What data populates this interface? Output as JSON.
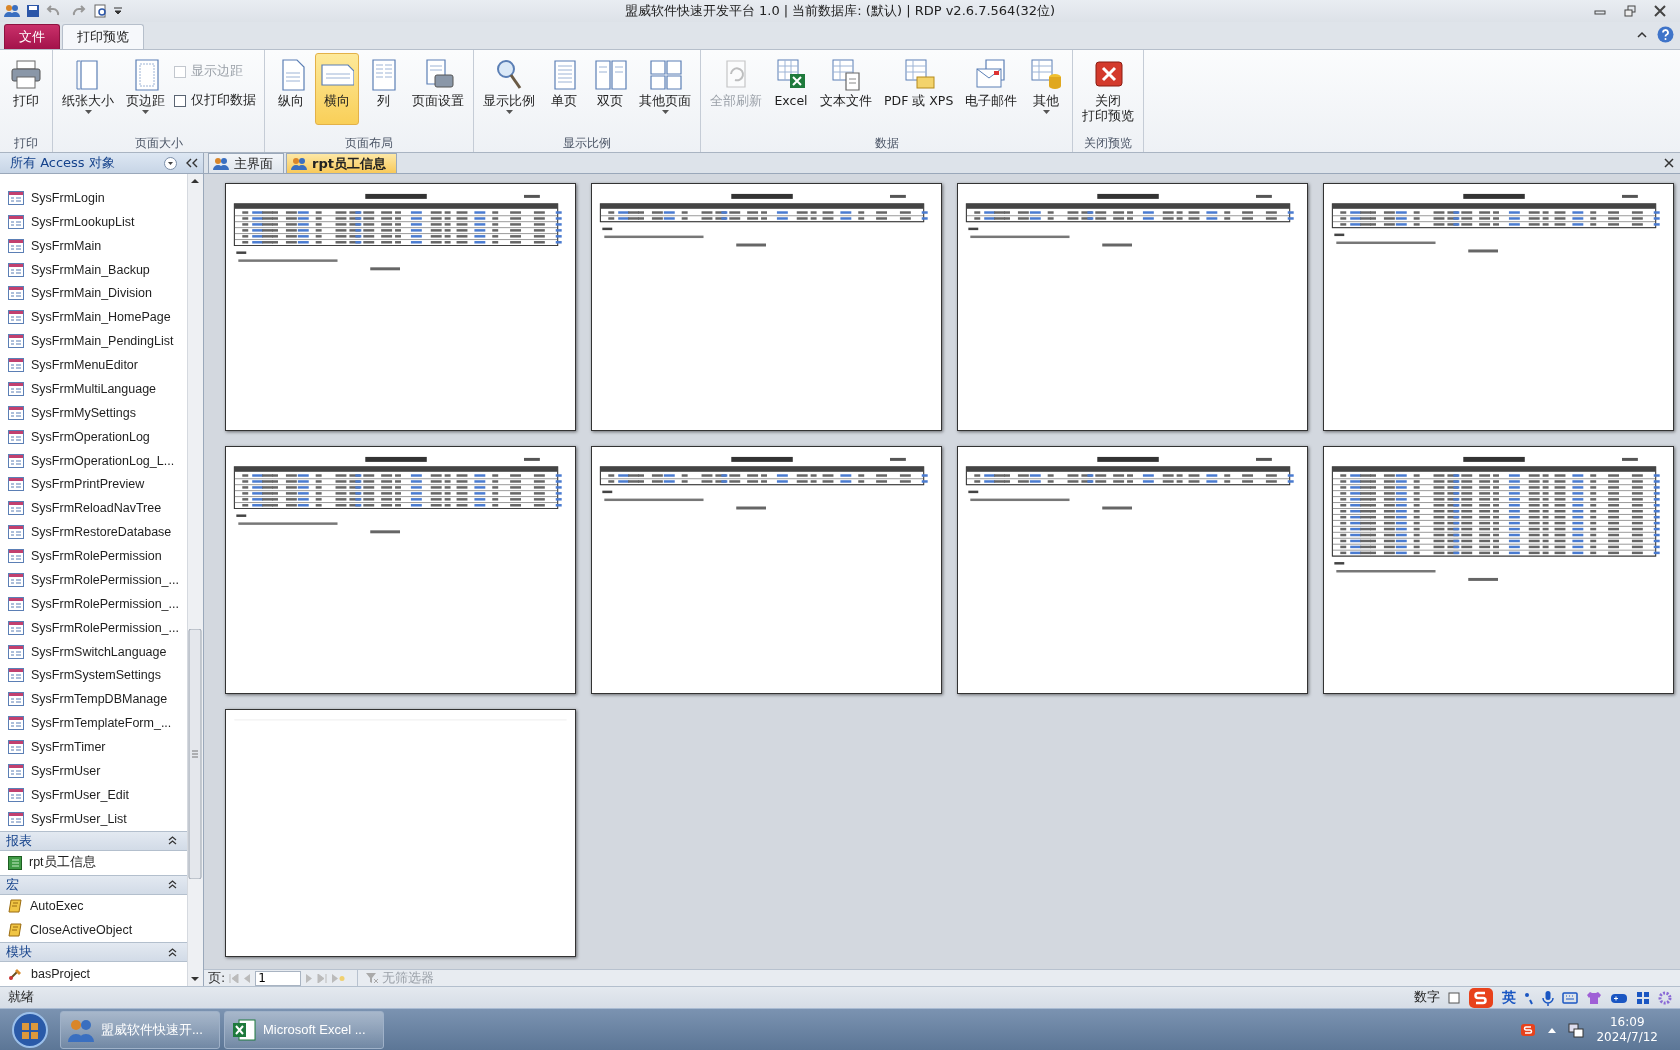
{
  "window": {
    "title": "盟威软件快速开发平台 1.0 | 当前数据库: (默认) | RDP v2.6.7.564(32位)"
  },
  "ribbon": {
    "tabs": [
      {
        "label": "文件",
        "kind": "file",
        "selected": false
      },
      {
        "label": "打印预览",
        "kind": "tab",
        "selected": true
      }
    ],
    "groups": [
      {
        "label": "打印",
        "items": [
          {
            "kind": "large",
            "label": "打印",
            "dropdown": false,
            "selected": false,
            "disabled": false
          }
        ]
      },
      {
        "label": "页面大小",
        "items": [
          {
            "kind": "large",
            "label": "纸张大小",
            "dropdown": true,
            "selected": false,
            "disabled": false
          },
          {
            "kind": "large",
            "label": "页边距",
            "dropdown": true,
            "selected": false,
            "disabled": false
          },
          {
            "kind": "checks",
            "checks": [
              {
                "label": "显示边距",
                "checked": false,
                "disabled": true
              },
              {
                "label": "仅打印数据",
                "checked": false,
                "disabled": false
              }
            ]
          }
        ]
      },
      {
        "label": "页面布局",
        "items": [
          {
            "kind": "large",
            "label": "纵向",
            "dropdown": false,
            "selected": false,
            "disabled": false
          },
          {
            "kind": "large",
            "label": "横向",
            "dropdown": false,
            "selected": true,
            "disabled": false
          },
          {
            "kind": "large",
            "label": "列",
            "dropdown": false,
            "selected": false,
            "disabled": false
          },
          {
            "kind": "large",
            "label": "页面设置",
            "dropdown": false,
            "selected": false,
            "disabled": false
          }
        ]
      },
      {
        "label": "显示比例",
        "items": [
          {
            "kind": "large",
            "label": "显示比例",
            "dropdown": true,
            "selected": false,
            "disabled": false
          },
          {
            "kind": "large",
            "label": "单页",
            "dropdown": false,
            "selected": false,
            "disabled": false
          },
          {
            "kind": "large",
            "label": "双页",
            "dropdown": false,
            "selected": false,
            "disabled": false
          },
          {
            "kind": "large",
            "label": "其他页面",
            "dropdown": true,
            "selected": false,
            "disabled": false
          }
        ]
      },
      {
        "label": "数据",
        "items": [
          {
            "kind": "large",
            "label": "全部刷新",
            "dropdown": false,
            "selected": false,
            "disabled": true
          },
          {
            "kind": "large",
            "label": "Excel",
            "dropdown": false,
            "selected": false,
            "disabled": false
          },
          {
            "kind": "large",
            "label": "文本文件",
            "dropdown": false,
            "selected": false,
            "disabled": false
          },
          {
            "kind": "large",
            "label": "PDF 或 XPS",
            "dropdown": false,
            "selected": false,
            "disabled": false
          },
          {
            "kind": "large",
            "label": "电子邮件",
            "dropdown": false,
            "selected": false,
            "disabled": false
          },
          {
            "kind": "large",
            "label": "其他",
            "dropdown": true,
            "selected": false,
            "disabled": false
          }
        ]
      },
      {
        "label": "关闭预览",
        "items": [
          {
            "kind": "large",
            "label": [
              "关闭",
              "打印预览"
            ],
            "dropdown": false,
            "selected": false,
            "disabled": false
          }
        ]
      }
    ]
  },
  "nav_pane": {
    "title": "所有 Access 对象",
    "groups": [
      {
        "kind": "form",
        "items": [
          "SysFrmLogin",
          "SysFrmLookupList",
          "SysFrmMain",
          "SysFrmMain_Backup",
          "SysFrmMain_Division",
          "SysFrmMain_HomePage",
          "SysFrmMain_PendingList",
          "SysFrmMenuEditor",
          "SysFrmMultiLanguage",
          "SysFrmMySettings",
          "SysFrmOperationLog",
          "SysFrmOperationLog_L...",
          "SysFrmPrintPreview",
          "SysFrmReloadNavTree",
          "SysFrmRestoreDatabase",
          "SysFrmRolePermission",
          "SysFrmRolePermission_...",
          "SysFrmRolePermission_...",
          "SysFrmRolePermission_...",
          "SysFrmSwitchLanguage",
          "SysFrmSystemSettings",
          "SysFrmTempDBManage",
          "SysFrmTemplateForm_...",
          "SysFrmTimer",
          "SysFrmUser",
          "SysFrmUser_Edit",
          "SysFrmUser_List"
        ]
      },
      {
        "kind": "report",
        "label": "报表",
        "expanded": true,
        "items": [
          "rpt员工信息"
        ]
      },
      {
        "kind": "macro",
        "label": "宏",
        "expanded": true,
        "items": [
          "AutoExec",
          "CloseActiveObject"
        ]
      },
      {
        "kind": "module",
        "label": "模块",
        "expanded": true,
        "items": [
          "basProject"
        ]
      }
    ]
  },
  "document_tabs": [
    {
      "label": "主界面",
      "selected": false
    },
    {
      "label": "rpt员工信息",
      "selected": true
    }
  ],
  "pages": [
    {
      "kind": "medium"
    },
    {
      "kind": "short"
    },
    {
      "kind": "short"
    },
    {
      "kind": "short3"
    },
    {
      "kind": "medium"
    },
    {
      "kind": "short"
    },
    {
      "kind": "short"
    },
    {
      "kind": "long"
    },
    {
      "kind": "blank"
    }
  ],
  "record_nav": {
    "label": "页:",
    "value": "1",
    "filter": "无筛选器"
  },
  "status_bar": {
    "left": "就绪",
    "right": "数字",
    "ime": "英"
  },
  "taskbar": {
    "items": [
      {
        "label": "盟威软件快速开...",
        "kind": "app"
      },
      {
        "label": "Microsoft Excel ...",
        "kind": "excel"
      }
    ],
    "time": "16:09",
    "date": "2024/7/12"
  }
}
